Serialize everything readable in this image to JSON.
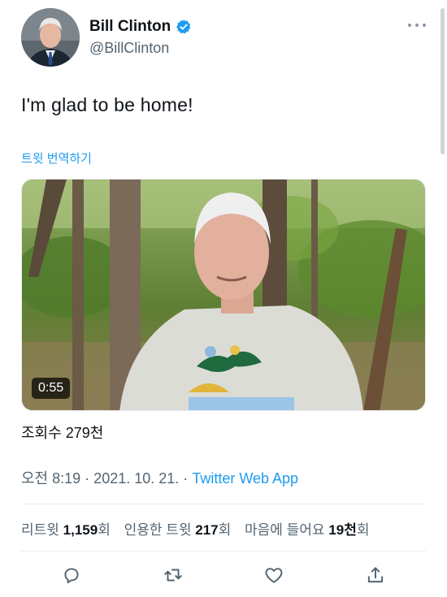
{
  "author": {
    "display_name": "Bill Clinton",
    "handle": "@BillClinton",
    "verified": true
  },
  "tweet": {
    "text": "I'm glad to be home!",
    "translate_label": "트윗 번역하기"
  },
  "media": {
    "type": "video",
    "duration": "0:55"
  },
  "views": {
    "label": "조회수",
    "count": "279천"
  },
  "meta": {
    "time": "오전 8:19",
    "separator": "·",
    "date": "2021. 10. 21.",
    "source": "Twitter Web App"
  },
  "stats": {
    "retweets": {
      "label": "리트윗",
      "count": "1,159",
      "suffix": "회"
    },
    "quotes": {
      "label": "인용한 트윗",
      "count": "217",
      "suffix": "회"
    },
    "likes": {
      "label": "마음에 들어요",
      "count": "19천",
      "suffix": "회"
    }
  },
  "actions": {
    "reply": "reply-icon",
    "retweet": "retweet-icon",
    "like": "heart-icon",
    "share": "share-icon"
  },
  "colors": {
    "accent": "#1d9bf0",
    "secondary_text": "#536471",
    "primary_text": "#0f1419"
  }
}
